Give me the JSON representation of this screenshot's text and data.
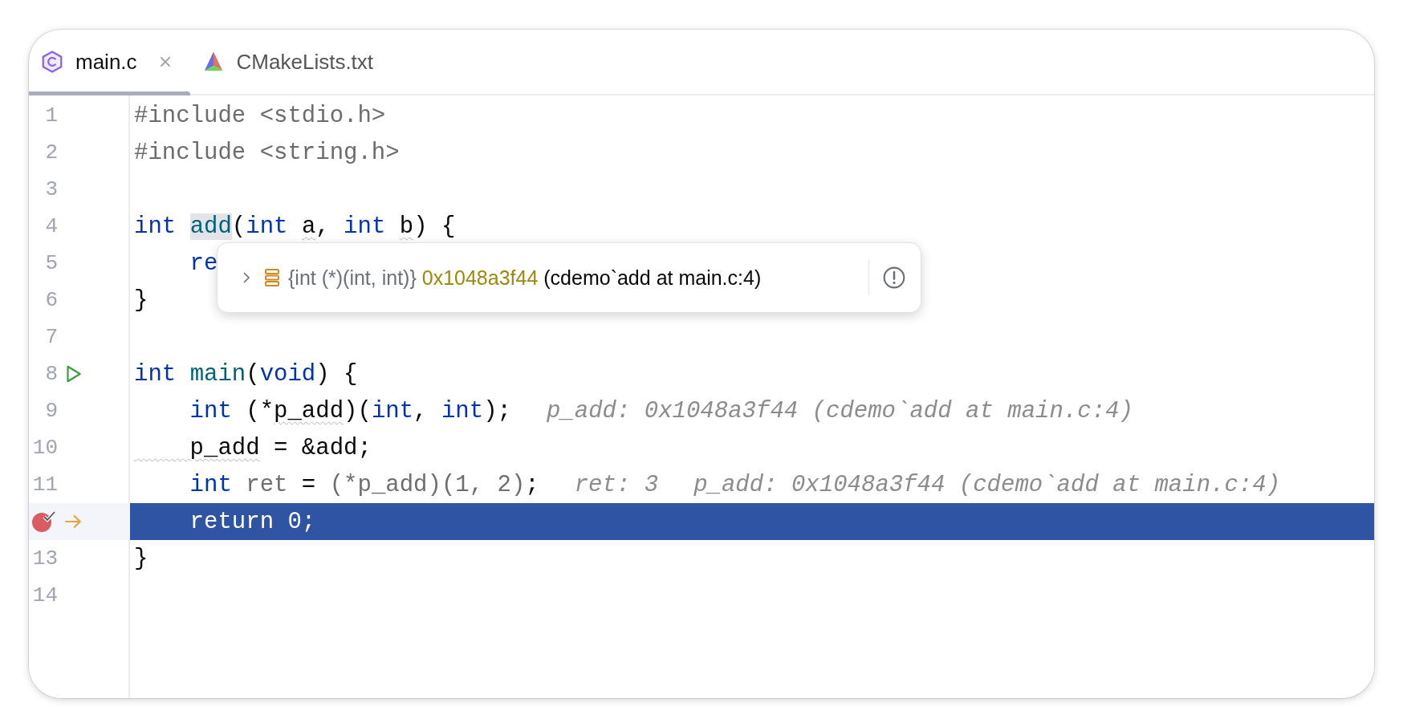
{
  "tabs": [
    {
      "label": "main.c",
      "kind": "c-source",
      "selected": true
    },
    {
      "label": "CMakeLists.txt",
      "kind": "cmake",
      "selected": false
    }
  ],
  "editor": {
    "lines": [
      {
        "number": "1",
        "kind": "plain",
        "current": false,
        "tokens": [
          {
            "text": "#include <stdio.h>",
            "kind": "directive"
          }
        ]
      },
      {
        "number": "2",
        "kind": "plain",
        "current": false,
        "tokens": [
          {
            "text": "#include <string.h>",
            "kind": "directive"
          }
        ]
      },
      {
        "number": "3",
        "kind": "plain",
        "current": false
      },
      {
        "number": "4",
        "kind": "plain",
        "current": false,
        "tokens": [
          {
            "text": "int ",
            "kind": "keyword"
          },
          {
            "text": "add",
            "kind": "usage"
          },
          {
            "text": "(",
            "kind": "plain"
          },
          {
            "text": "int ",
            "kind": "keyword"
          },
          {
            "text": "a",
            "kind": "warn"
          },
          {
            "text": ", ",
            "kind": "plain"
          },
          {
            "text": "int ",
            "kind": "keyword"
          },
          {
            "text": "b",
            "kind": "warn"
          },
          {
            "text": ") {",
            "kind": "plain"
          }
        ]
      },
      {
        "number": "5",
        "kind": "plain",
        "current": false,
        "tokens": [
          {
            "text": "    re",
            "kind": "keyword"
          }
        ]
      },
      {
        "number": "6",
        "kind": "plain",
        "current": false,
        "tokens": [
          {
            "text": "}",
            "kind": "plain"
          }
        ]
      },
      {
        "number": "7",
        "kind": "plain",
        "current": false
      },
      {
        "number": "8",
        "kind": "entry",
        "current": false,
        "tokens": [
          {
            "text": "int ",
            "kind": "keyword"
          },
          {
            "text": "main",
            "kind": "function"
          },
          {
            "text": "(",
            "kind": "plain"
          },
          {
            "text": "void",
            "kind": "keyword"
          },
          {
            "text": ") {",
            "kind": "plain"
          }
        ]
      },
      {
        "number": "9",
        "kind": "plain",
        "current": false,
        "tokens": [
          {
            "text": "    int",
            "kind": "keyword"
          },
          {
            "text": " (*",
            "kind": "plain"
          },
          {
            "text": "p_add",
            "kind": "warn"
          },
          {
            "text": ")(",
            "kind": "plain"
          },
          {
            "text": "int",
            "kind": "keyword"
          },
          {
            "text": ", ",
            "kind": "plain"
          },
          {
            "text": "int",
            "kind": "keyword"
          },
          {
            "text": ");",
            "kind": "plain"
          }
        ],
        "hints": [
          "p_add: 0x1048a3f44 (cdemo`add at main.c:4)"
        ]
      },
      {
        "number": "10",
        "kind": "plain",
        "current": false,
        "tokens": [
          {
            "text": "    p_add",
            "kind": "warn"
          },
          {
            "text": " = &add;",
            "kind": "plain"
          }
        ]
      },
      {
        "number": "11",
        "kind": "plain",
        "current": false,
        "tokens": [
          {
            "text": "    int ",
            "kind": "keyword"
          },
          {
            "text": "ret",
            "kind": "dim"
          },
          {
            "text": " = ",
            "kind": "plain"
          },
          {
            "text": "(*p_add)(1, 2)",
            "kind": "dim"
          },
          {
            "text": ";",
            "kind": "plain"
          }
        ],
        "hints": [
          "ret: 3",
          "p_add: 0x1048a3f44 (cdemo`add at main.c:4)"
        ]
      },
      {
        "kind": "breakpoint",
        "current": true,
        "tokens": [
          {
            "text": "    return 0;",
            "kind": "keyword"
          }
        ]
      },
      {
        "number": "13",
        "kind": "plain",
        "current": false,
        "tokens": [
          {
            "text": "}",
            "kind": "plain"
          }
        ]
      },
      {
        "number": "14",
        "kind": "plain",
        "current": false
      }
    ]
  },
  "popup": {
    "type": "{int (*)(int, int)}",
    "value": "0x1048a3f44",
    "description": "(cdemo`add at main.c:4)",
    "expanded": false
  }
}
